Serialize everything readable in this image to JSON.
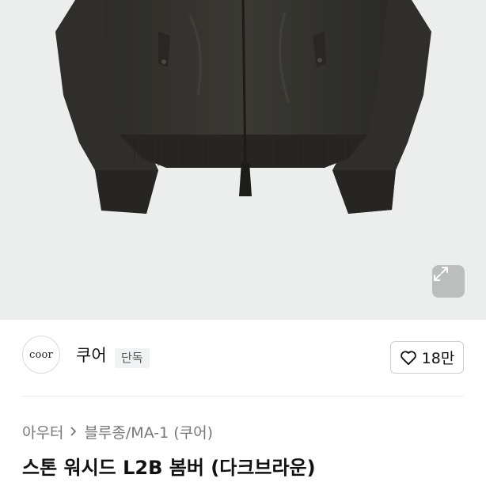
{
  "product_image": {
    "alt": "jacket-photo"
  },
  "expand_icon": "expand-icon",
  "brand": {
    "logo_text": "coor",
    "name": "쿠어",
    "badge": "단독"
  },
  "like": {
    "icon": "heart-icon",
    "count": "18만"
  },
  "breadcrumb": {
    "category": "아우터",
    "separator_icon": "chevron-right-icon",
    "subcategory": "블루종/MA-1 (쿠어)"
  },
  "product": {
    "title": "스톤 워시드 L2B 봄버 (다크브라운)"
  },
  "colors": {
    "jacket": "#35342f",
    "background": "#eceded",
    "text": "#111111",
    "muted": "#777777"
  }
}
